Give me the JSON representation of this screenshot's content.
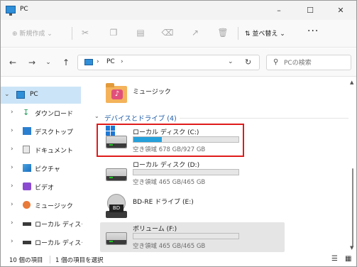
{
  "window": {
    "title": "PC"
  },
  "commandbar": {
    "new_label": "新規作成",
    "sort_label": "並べ替え",
    "more_label": "···"
  },
  "address": {
    "location": "PC",
    "search_placeholder": "PCの検索"
  },
  "sidebar": {
    "items": [
      {
        "label": "PC",
        "icon": "pc-icon",
        "selected": true
      },
      {
        "label": "ダウンロード",
        "icon": "download-icon"
      },
      {
        "label": "デスクトップ",
        "icon": "desktop-icon"
      },
      {
        "label": "ドキュメント",
        "icon": "document-icon"
      },
      {
        "label": "ピクチャ",
        "icon": "picture-icon"
      },
      {
        "label": "ビデオ",
        "icon": "video-icon"
      },
      {
        "label": "ミュージック",
        "icon": "music-icon"
      },
      {
        "label": "ローカル ディスク (",
        "icon": "drive-icon"
      },
      {
        "label": "ローカル ディスク (",
        "icon": "drive-icon"
      }
    ]
  },
  "content": {
    "music_folder": "ミュージック",
    "section_title": "デバイスとドライブ (4)",
    "drives": [
      {
        "name": "ローカル ディスク (C:)",
        "space": "空き領域 678 GB/927 GB",
        "used_fraction": 0.27,
        "icon": "windows-drive-icon"
      },
      {
        "name": "ローカル ディスク (D:)",
        "space": "空き領域 465 GB/465 GB",
        "used_fraction": 0.0,
        "icon": "drive-icon"
      },
      {
        "name": "BD-RE ドライブ (E:)",
        "bd_label": "BD",
        "icon": "bluray-drive-icon"
      },
      {
        "name": "ボリューム (F:)",
        "space": "空き領域 465 GB/465 GB",
        "used_fraction": 0.0,
        "icon": "drive-icon"
      }
    ]
  },
  "status": {
    "item_count": "10 個の項目",
    "selected": "1 個の項目を選択"
  },
  "colors": {
    "accent": "#26a0da",
    "highlight": "#e01b1b",
    "selection": "#cce4f7"
  }
}
